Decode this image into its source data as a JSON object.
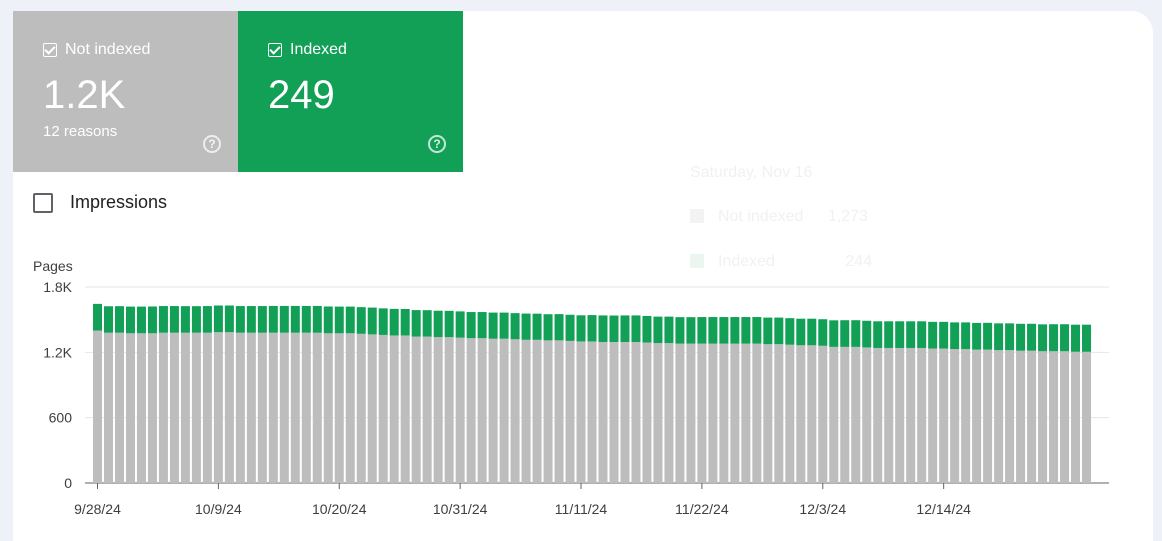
{
  "tiles": {
    "not_indexed": {
      "label": "Not indexed",
      "value": "1.2K",
      "sub": "12 reasons",
      "help": "?"
    },
    "indexed": {
      "label": "Indexed",
      "value": "249",
      "help": "?"
    }
  },
  "impressions": {
    "label": "Impressions"
  },
  "tooltip": {
    "date": "Saturday, Nov 16",
    "rows": [
      {
        "label": "Not indexed",
        "value": "1,273"
      },
      {
        "label": "Indexed",
        "value": "244"
      }
    ]
  },
  "chart_data": {
    "type": "bar",
    "stacked": true,
    "ylabel": "Pages",
    "ylim": [
      0,
      1800
    ],
    "yticks": [
      "0",
      "600",
      "1.2K",
      "1.8K"
    ],
    "yticks_values": [
      0,
      600,
      1200,
      1800
    ],
    "xtick_labels": [
      "9/28/24",
      "10/9/24",
      "10/20/24",
      "10/31/24",
      "11/11/24",
      "11/22/24",
      "12/3/24",
      "12/14/24"
    ],
    "xtick_indices": [
      0,
      11,
      22,
      33,
      44,
      55,
      66,
      77
    ],
    "colors": {
      "not_indexed": "#bdbdbd",
      "indexed": "#11a056"
    },
    "grid": true,
    "series": [
      {
        "name": "Not indexed",
        "values": [
          1400,
          1380,
          1380,
          1375,
          1375,
          1375,
          1380,
          1380,
          1380,
          1380,
          1380,
          1385,
          1385,
          1380,
          1380,
          1380,
          1380,
          1380,
          1380,
          1380,
          1380,
          1375,
          1375,
          1375,
          1370,
          1365,
          1360,
          1355,
          1355,
          1345,
          1345,
          1340,
          1340,
          1335,
          1330,
          1330,
          1325,
          1325,
          1320,
          1315,
          1315,
          1310,
          1310,
          1305,
          1300,
          1300,
          1295,
          1295,
          1295,
          1295,
          1290,
          1285,
          1285,
          1280,
          1280,
          1280,
          1280,
          1280,
          1280,
          1280,
          1280,
          1275,
          1275,
          1270,
          1265,
          1265,
          1260,
          1250,
          1250,
          1250,
          1245,
          1240,
          1240,
          1240,
          1240,
          1240,
          1235,
          1235,
          1230,
          1230,
          1225,
          1225,
          1220,
          1220,
          1215,
          1215,
          1210,
          1210,
          1210,
          1205,
          1205
        ]
      },
      {
        "name": "Indexed",
        "values": [
          245,
          243,
          244,
          245,
          245,
          246,
          245,
          245,
          244,
          244,
          245,
          245,
          245,
          245,
          245,
          245,
          246,
          246,
          246,
          246,
          246,
          246,
          245,
          245,
          245,
          246,
          244,
          244,
          243,
          243,
          242,
          242,
          241,
          241,
          240,
          240,
          240,
          240,
          240,
          241,
          240,
          240,
          241,
          240,
          240,
          242,
          244,
          243,
          244,
          244,
          244,
          243,
          243,
          243,
          243,
          244,
          244,
          244,
          244,
          244,
          244,
          244,
          244,
          244,
          244,
          244,
          244,
          244,
          245,
          245,
          245,
          245,
          245,
          245,
          245,
          245,
          245,
          245,
          245,
          245,
          245,
          246,
          246,
          246,
          247,
          247,
          247,
          248,
          248,
          249,
          249
        ]
      }
    ]
  }
}
